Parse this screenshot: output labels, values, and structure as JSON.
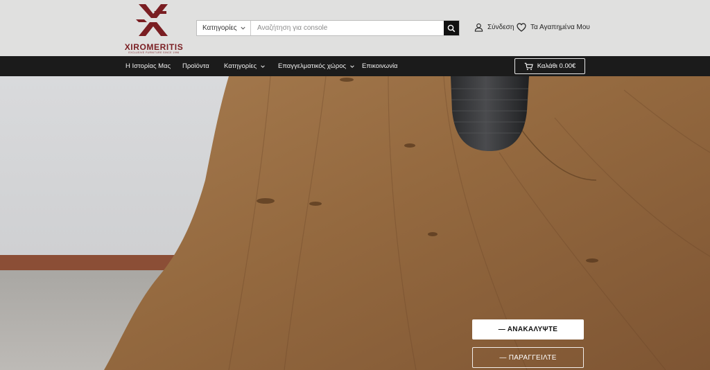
{
  "brand": {
    "name": "XIROMERITIS",
    "tagline": "EXCLUSIVE FURNITURE SINCE 1996",
    "colors": {
      "primary": "#7a1e22",
      "header_bg": "#e0e0df",
      "nav_bg": "#1b1b1b"
    }
  },
  "search": {
    "category_label": "Κατηγορίες",
    "placeholder": "Αναζήτηση για console",
    "value": "",
    "submit_icon": "search-icon"
  },
  "account": {
    "login_label": "Σύνδεση",
    "login_icon": "user-icon",
    "favorites_label": "Τα Αγαπημένα Μου",
    "favorites_icon": "heart-icon"
  },
  "nav": {
    "items": [
      {
        "label": "Η Ιστορίας Μας"
      },
      {
        "label": "Προϊόντα"
      },
      {
        "label": "Κατηγορίες",
        "has_dropdown": true
      },
      {
        "label": "Επαγγελματικός χώρος",
        "has_dropdown": true
      },
      {
        "label": "Επικοινωνία"
      }
    ],
    "cart": {
      "label": "Καλάθι 0.00€",
      "icon": "cart-icon"
    }
  },
  "hero": {
    "image": "wooden-table-with-vase",
    "primary_button": "— ΑΝΑΚΑΛΥΨΤΕ",
    "secondary_button": "— ΠΑΡΑΓΓΕΙΛΤΕ"
  }
}
